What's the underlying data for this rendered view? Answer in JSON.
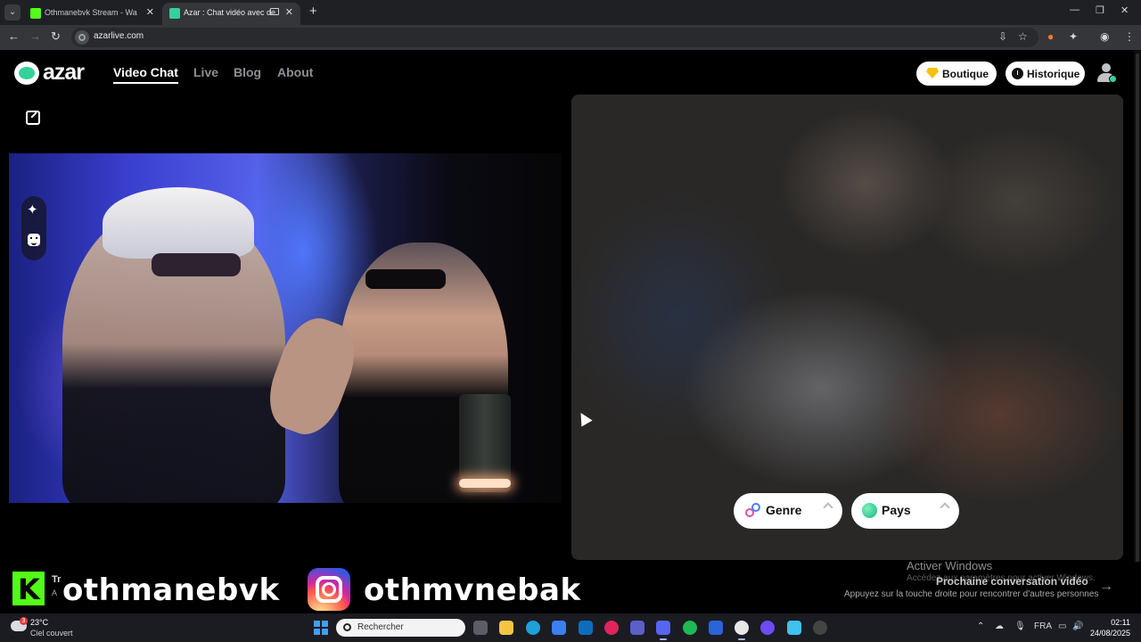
{
  "browser": {
    "tabs": [
      {
        "title": "Othmanebvk Stream - Watch Li",
        "favicon_color": "#53fc18"
      },
      {
        "title": "Azar : Chat vidéo avec de n",
        "favicon_color": "#32d29a"
      }
    ],
    "url": "azarlive.com"
  },
  "nav": {
    "logo_text": "azar",
    "links": [
      "Video Chat",
      "Live",
      "Blog",
      "About"
    ],
    "active_link": "Video Chat",
    "shop_label": "Boutique",
    "history_label": "Historique"
  },
  "filters": {
    "gender_label": "Genre",
    "country_label": "Pays"
  },
  "overlay": {
    "kick_name": "othmanebvk",
    "instagram_name": "othmvnebak",
    "ghost_title": "Tr",
    "ghost_sub": "A",
    "next_title": "Prochaine conversation vidéo",
    "next_sub": "Appuyez sur la touche droite pour rencontrer d'autres personnes",
    "activate_title": "Activer Windows",
    "activate_sub": "Accédez aux paramètres pour activer Windows."
  },
  "taskbar": {
    "weather_badge": "3",
    "temperature": "23°C",
    "condition": "Ciel couvert",
    "search_placeholder": "Rechercher",
    "language": "FRA",
    "time": "02:11",
    "date": "24/08/2025"
  },
  "colors": {
    "accent": "#32d29a",
    "kick_green": "#53fc18"
  }
}
